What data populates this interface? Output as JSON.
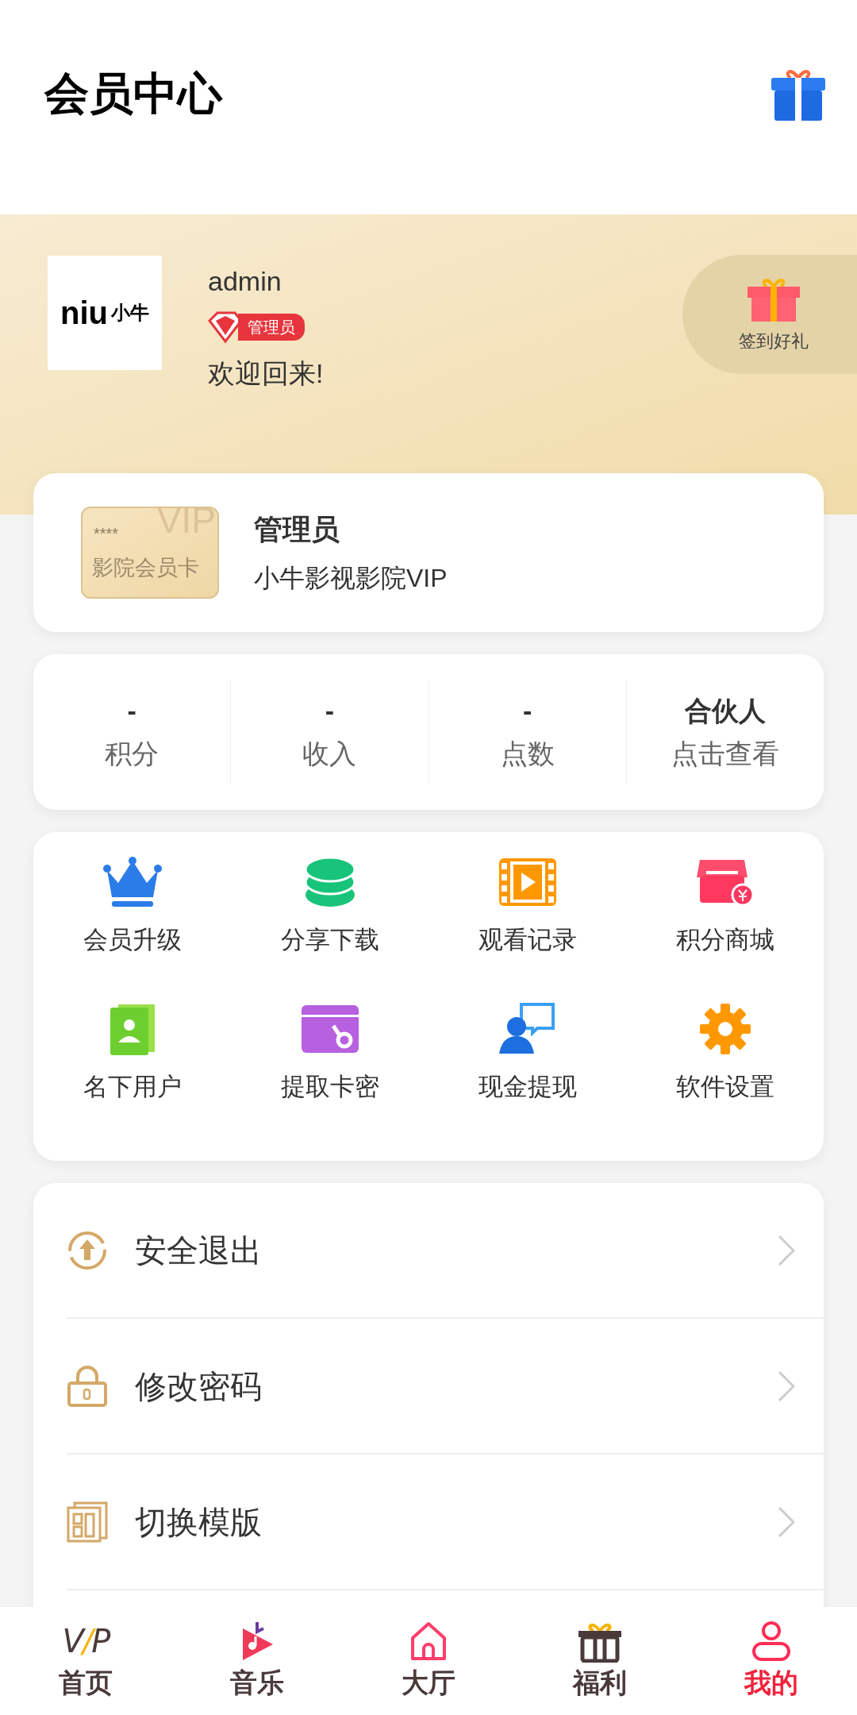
{
  "header": {
    "title": "会员中心"
  },
  "profile": {
    "logo_text": "niu",
    "logo_text_2": "小牛",
    "username": "admin",
    "badge": "管理员",
    "greeting": "欢迎回来!",
    "checkin": "签到好礼"
  },
  "member_card": {
    "card_stars": "****",
    "card_watermark": "VIP",
    "card_label": "影院会员卡",
    "title": "管理员",
    "subtitle": "小牛影视影院VIP"
  },
  "stats": [
    {
      "value": "-",
      "label": "积分"
    },
    {
      "value": "-",
      "label": "收入"
    },
    {
      "value": "-",
      "label": "点数"
    },
    {
      "value": "合伙人",
      "label": "点击查看"
    }
  ],
  "shortcuts": [
    {
      "kind": "crown",
      "label": "会员升级"
    },
    {
      "kind": "coins",
      "label": "分享下载"
    },
    {
      "kind": "film",
      "label": "观看记录"
    },
    {
      "kind": "shop",
      "label": "积分商城"
    },
    {
      "kind": "contacts",
      "label": "名下用户"
    },
    {
      "kind": "card",
      "label": "提取卡密"
    },
    {
      "kind": "chat",
      "label": "现金提现"
    },
    {
      "kind": "gear",
      "label": "软件设置"
    }
  ],
  "menu": [
    {
      "kind": "logout",
      "label": "安全退出"
    },
    {
      "kind": "lock",
      "label": "修改密码"
    },
    {
      "kind": "template",
      "label": "切换模版"
    }
  ],
  "tab_bar": [
    {
      "kind": "vip",
      "logo": "V/P",
      "label": "首页",
      "selected": false
    },
    {
      "kind": "music",
      "label": "音乐",
      "selected": false
    },
    {
      "kind": "home",
      "label": "大厅",
      "selected": false
    },
    {
      "kind": "gift",
      "label": "福利",
      "selected": false
    },
    {
      "kind": "user",
      "label": "我的",
      "selected": true
    }
  ]
}
